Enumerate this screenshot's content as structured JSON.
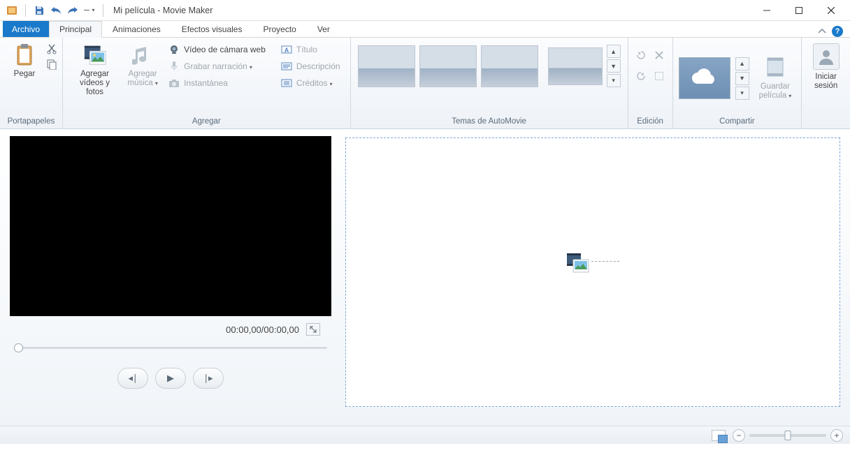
{
  "titlebar": {
    "title": "Mi película - Movie Maker"
  },
  "tabs": {
    "file": "Archivo",
    "items": [
      "Principal",
      "Animaciones",
      "Efectos visuales",
      "Proyecto",
      "Ver"
    ],
    "active": 0
  },
  "ribbon": {
    "clipboard": {
      "label": "Portapapeles",
      "paste": "Pegar"
    },
    "add": {
      "label": "Agregar",
      "add_media": "Agregar\nvídeos y fotos",
      "add_music": "Agregar\nmúsica",
      "webcam": "Vídeo de cámara web",
      "narration": "Grabar narración",
      "snapshot": "Instantánea",
      "title": "Título",
      "description": "Descripción",
      "credits": "Créditos"
    },
    "automovie": {
      "label": "Temas de AutoMovie"
    },
    "edit": {
      "label": "Edición"
    },
    "share": {
      "label": "Compartir",
      "save_movie": "Guardar\npelícula"
    },
    "signin": {
      "label": "Iniciar\nsesión"
    }
  },
  "player": {
    "time": "00:00,00/00:00,00"
  }
}
